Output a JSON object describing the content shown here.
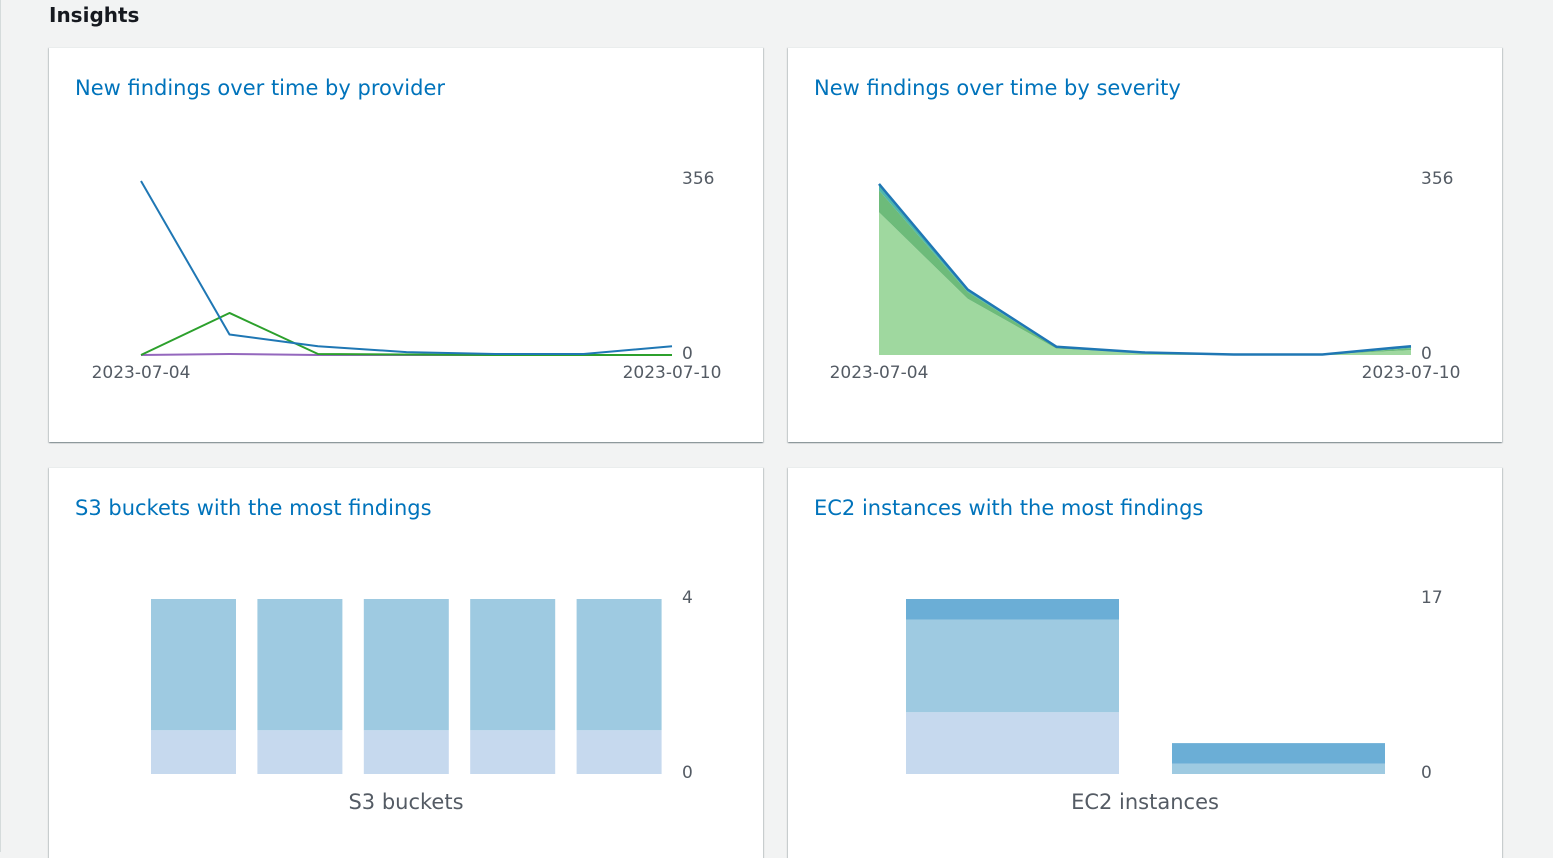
{
  "section": {
    "title": "Insights"
  },
  "cards": {
    "provider": {
      "title": "New findings over time by provider",
      "chart_data": {
        "type": "line",
        "x": [
          "2023-07-04",
          "2023-07-05",
          "2023-07-06",
          "2023-07-07",
          "2023-07-08",
          "2023-07-09",
          "2023-07-10"
        ],
        "x_tick_labels": [
          "2023-07-04",
          "2023-07-10"
        ],
        "y_tick_labels": [
          "356",
          "0"
        ],
        "ylim": [
          0,
          356
        ],
        "series": [
          {
            "color": "#1f77b4",
            "values": [
              356,
              42,
              18,
              6,
              2,
              2,
              18
            ]
          },
          {
            "color": "#2ca02c",
            "values": [
              0,
              86,
              2,
              1,
              0,
              0,
              0
            ]
          },
          {
            "color": "#9467bd",
            "values": [
              0,
              2,
              0,
              0,
              0,
              0,
              0
            ]
          }
        ]
      }
    },
    "severity": {
      "title": "New findings over time by severity",
      "chart_data": {
        "type": "area",
        "stacked": true,
        "x": [
          "2023-07-04",
          "2023-07-05",
          "2023-07-06",
          "2023-07-07",
          "2023-07-08",
          "2023-07-09",
          "2023-07-10"
        ],
        "x_tick_labels": [
          "2023-07-04",
          "2023-07-10"
        ],
        "y_tick_labels": [
          "356",
          "0"
        ],
        "ylim": [
          0,
          356
        ],
        "series": [
          {
            "color": "#9fd89f",
            "values": [
              292,
              115,
              13,
              4,
              1,
              1,
              10
            ]
          },
          {
            "color": "#6dbb7a",
            "values": [
              45,
              14,
              2,
              1,
              0,
              0,
              4
            ]
          },
          {
            "color": "#4db6ac",
            "values": [
              9,
              3,
              1,
              0,
              0,
              0,
              2
            ]
          },
          {
            "color": "#1f77b4",
            "values": [
              4,
              2,
              1,
              0,
              0,
              0,
              2
            ]
          }
        ]
      }
    },
    "s3": {
      "title": "S3 buckets with the most findings",
      "chart_data": {
        "type": "bar",
        "stacked": true,
        "xlabel": "S3 buckets",
        "y_tick_labels": [
          "4",
          "0"
        ],
        "ylim": [
          0,
          4
        ],
        "categories": [
          "",
          "",
          "",
          "",
          ""
        ],
        "series": [
          {
            "color": "#c6d9ee",
            "values": [
              1,
              1,
              1,
              1,
              1
            ]
          },
          {
            "color": "#9ecae1",
            "values": [
              3,
              3,
              3,
              3,
              3
            ]
          }
        ]
      }
    },
    "ec2": {
      "title": "EC2 instances with the most findings",
      "chart_data": {
        "type": "bar",
        "stacked": true,
        "xlabel": "EC2 instances",
        "y_tick_labels": [
          "17",
          "0"
        ],
        "ylim": [
          0,
          17
        ],
        "categories": [
          "",
          ""
        ],
        "series": [
          {
            "color": "#c6d9ee",
            "values": [
              6,
              0
            ]
          },
          {
            "color": "#9ecae1",
            "values": [
              9,
              1
            ]
          },
          {
            "color": "#6baed6",
            "values": [
              2,
              2
            ]
          }
        ]
      }
    }
  }
}
